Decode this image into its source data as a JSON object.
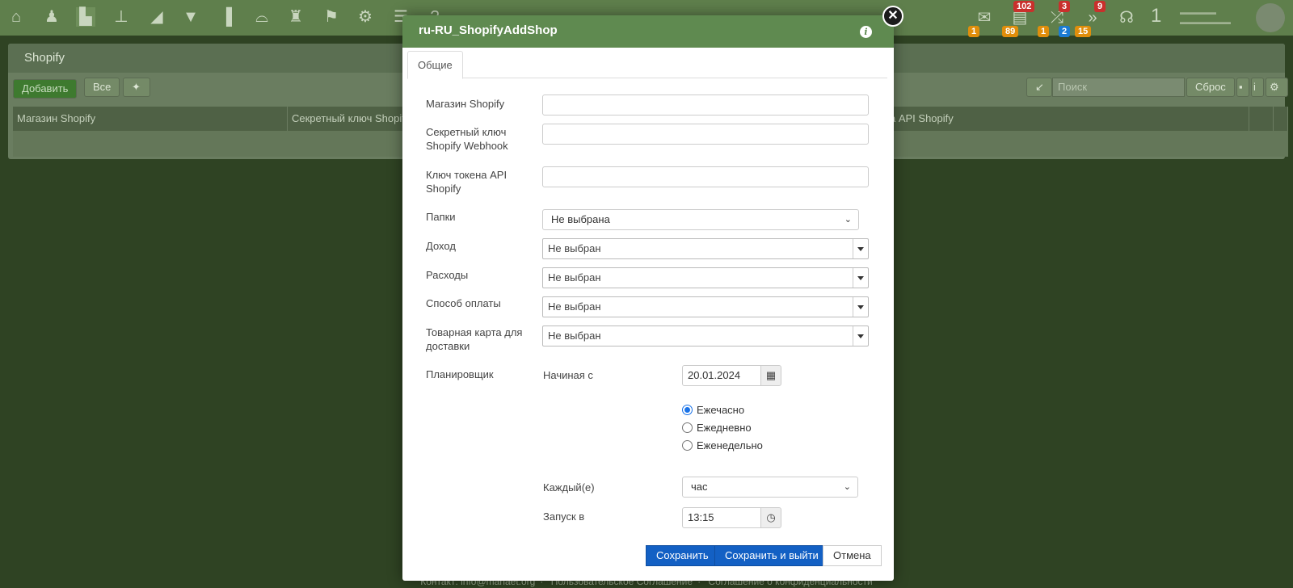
{
  "app": {
    "panel_title": "Shopify",
    "add_label": "Добавить",
    "all_label": "Все",
    "search_placeholder": "Поиск",
    "reset_label": "Сброс",
    "grid_columns": [
      "Магазин Shopify",
      "Секретный ключ Shopify",
      "а API Shopify"
    ],
    "top_number": "1",
    "badges": {
      "mail": "1",
      "tasks_top": "102",
      "tasks_bottom": "89",
      "shuffle_top": "3",
      "shuffle_bottom_a": "1",
      "shuffle_bottom_b": "2",
      "forward_top": "9",
      "forward_bottom": "15"
    }
  },
  "footer": {
    "contact": "Контакт: info@manaet.org",
    "agreement": "Пользовательское Соглашение",
    "privacy": "Соглашение о конфиденциальности"
  },
  "modal": {
    "title": "ru-RU_ShopifyAddShop",
    "tab_general": "Общие",
    "fields": {
      "shop_label": "Магазин Shopify",
      "secret_label": "Секретный ключ Shopify Webhook",
      "token_label": "Ключ токена API Shopify",
      "folders_label": "Папки",
      "folders_value": "Не выбрана",
      "income_label": "Доход",
      "income_value": "Не выбран",
      "expenses_label": "Расходы",
      "expenses_value": "Не выбран",
      "payment_label": "Способ оплаты",
      "payment_value": "Не выбран",
      "shipping_label": "Товарная карта для доставки",
      "shipping_value": "Не выбран"
    },
    "scheduler": {
      "label": "Планировщик",
      "start_label": "Начиная с",
      "start_date": "20.01.2024",
      "options": [
        "Ежечасно",
        "Ежедневно",
        "Еженедельно"
      ],
      "selected_option": "Ежечасно",
      "every_label": "Каждый(е)",
      "every_value": "час",
      "run_label": "Запуск в",
      "run_time": "13:15"
    },
    "buttons": {
      "save": "Сохранить",
      "save_exit": "Сохранить и выйти",
      "cancel": "Отмена"
    }
  }
}
